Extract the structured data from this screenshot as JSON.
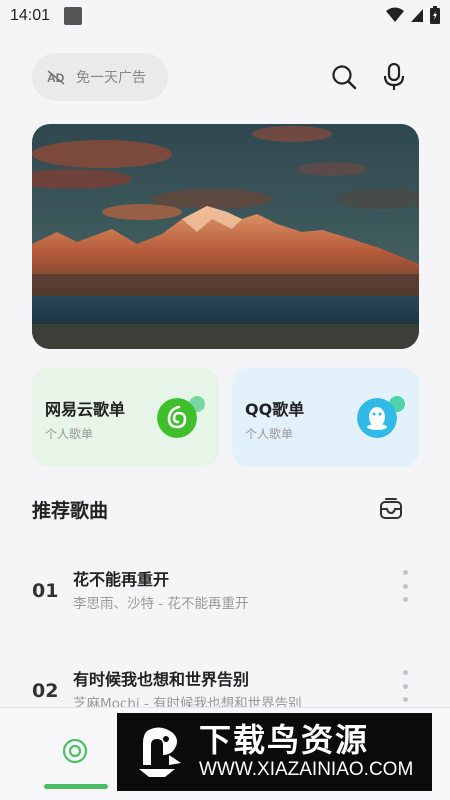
{
  "status_bar": {
    "time": "14:01",
    "icons": [
      "notification-icon",
      "wifi-icon",
      "signal-icon",
      "battery-icon"
    ]
  },
  "header": {
    "ad_free_label": "免一天广告",
    "search_icon": "search-icon",
    "mic_icon": "microphone-icon"
  },
  "playlists": [
    {
      "title": "网易云歌单",
      "subtitle": "个人歌单",
      "logo_color": "#3fbf2e",
      "bg": "#e6f5e7"
    },
    {
      "title": "QQ歌单",
      "subtitle": "个人歌单",
      "logo_color": "#31b9e8",
      "bg": "#e3f1fb"
    }
  ],
  "recommend": {
    "title": "推荐歌曲",
    "songs": [
      {
        "no": "01",
        "title": "花不能再重开",
        "subtitle": "李思雨、沙特 - 花不能再重开"
      },
      {
        "no": "02",
        "title": "有时候我也想和世界告别",
        "subtitle": "芝麻Mochi - 有时候我也想和世界告别"
      }
    ]
  },
  "watermark": {
    "brand": "下载鸟资源",
    "url": "WWW.XIAZAINIAO.COM"
  },
  "colors": {
    "accent": "#4bbf62",
    "background": "#f5f5f7"
  }
}
